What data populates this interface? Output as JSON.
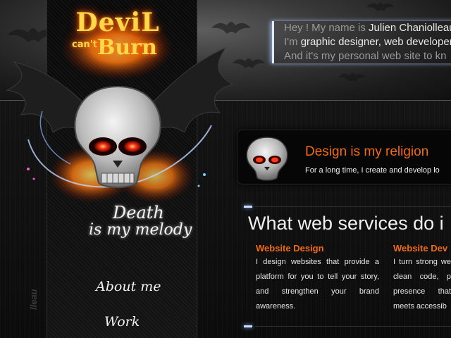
{
  "header": {
    "intro_lines": [
      {
        "prefix": "Hey ! My name is ",
        "highlight": "Julien Chaniolleau"
      },
      {
        "prefix": "I'm ",
        "highlight": "graphic designer, web developer"
      },
      {
        "prefix": "And it's my personal web site to kn",
        "highlight": ""
      }
    ]
  },
  "logo": {
    "line1": "DeviL",
    "line2": "can't",
    "line3": "Burn"
  },
  "tagline": {
    "line1": "Death",
    "line2": "is my melody"
  },
  "sidebar": {
    "vertical_text": "lleau",
    "nav": [
      {
        "label": "About me"
      },
      {
        "label": "Work"
      }
    ]
  },
  "callout": {
    "title": "Design is my religion",
    "description": "For a long time, I create and develop lo"
  },
  "services": {
    "heading": "What web services do i",
    "items": [
      {
        "title": "Website Design",
        "description": "I design websites that provide a platform for you to tell your story, and strengthen your brand awareness."
      },
      {
        "title": "Website Dev",
        "description": "I turn strong we clean code, p presence that meets accessib"
      }
    ]
  },
  "colors": {
    "accent_orange": "#f36a12",
    "glow_blue": "#cfe0ff"
  }
}
